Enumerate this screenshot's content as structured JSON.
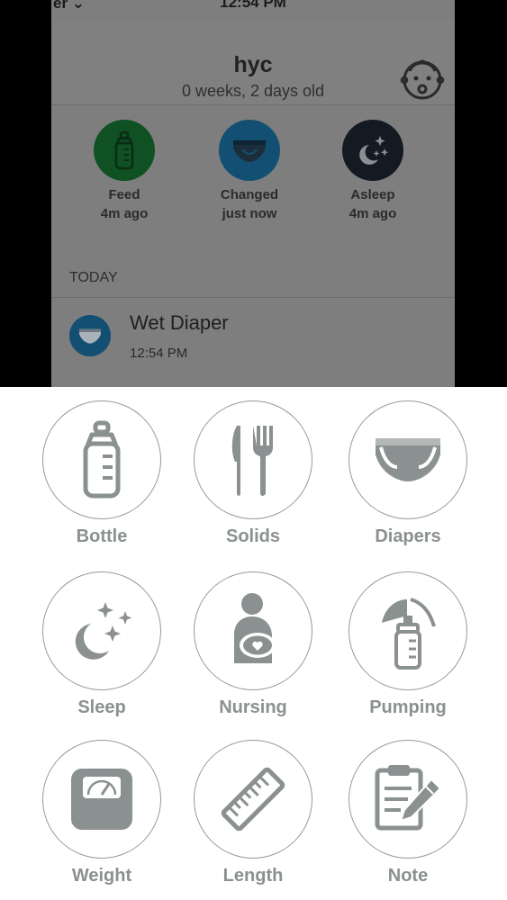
{
  "status_bar": {
    "carrier": "er ⌄",
    "time": "12:54 PM"
  },
  "header": {
    "name": "hyc",
    "age": "0 weeks, 2 days old",
    "profile_icon": "baby-face-icon"
  },
  "quick_status": [
    {
      "title": "Feed",
      "time": "4m ago",
      "color": "#0f5122",
      "icon": "bottle-icon"
    },
    {
      "title": "Changed",
      "time": "just now",
      "color": "#134f72",
      "icon": "diaper-icon"
    },
    {
      "title": "Asleep",
      "time": "4m ago",
      "color": "#141a22",
      "icon": "moon-stars-icon"
    }
  ],
  "timeline": {
    "section": "TODAY",
    "entries": [
      {
        "title": "Wet Diaper",
        "time": "12:54 PM",
        "icon": "diaper-icon"
      }
    ]
  },
  "actions": [
    {
      "label": "Bottle",
      "icon": "bottle-icon"
    },
    {
      "label": "Solids",
      "icon": "fork-knife-icon"
    },
    {
      "label": "Diapers",
      "icon": "diaper-icon"
    },
    {
      "label": "Sleep",
      "icon": "moon-stars-icon"
    },
    {
      "label": "Nursing",
      "icon": "nursing-icon"
    },
    {
      "label": "Pumping",
      "icon": "breast-pump-icon"
    },
    {
      "label": "Weight",
      "icon": "scale-icon"
    },
    {
      "label": "Length",
      "icon": "ruler-icon"
    },
    {
      "label": "Note",
      "icon": "note-icon"
    }
  ],
  "colors": {
    "icon_gray": "#8a9190",
    "dim_overlay": "#7e7e7e",
    "sheet": "#ffffff"
  }
}
